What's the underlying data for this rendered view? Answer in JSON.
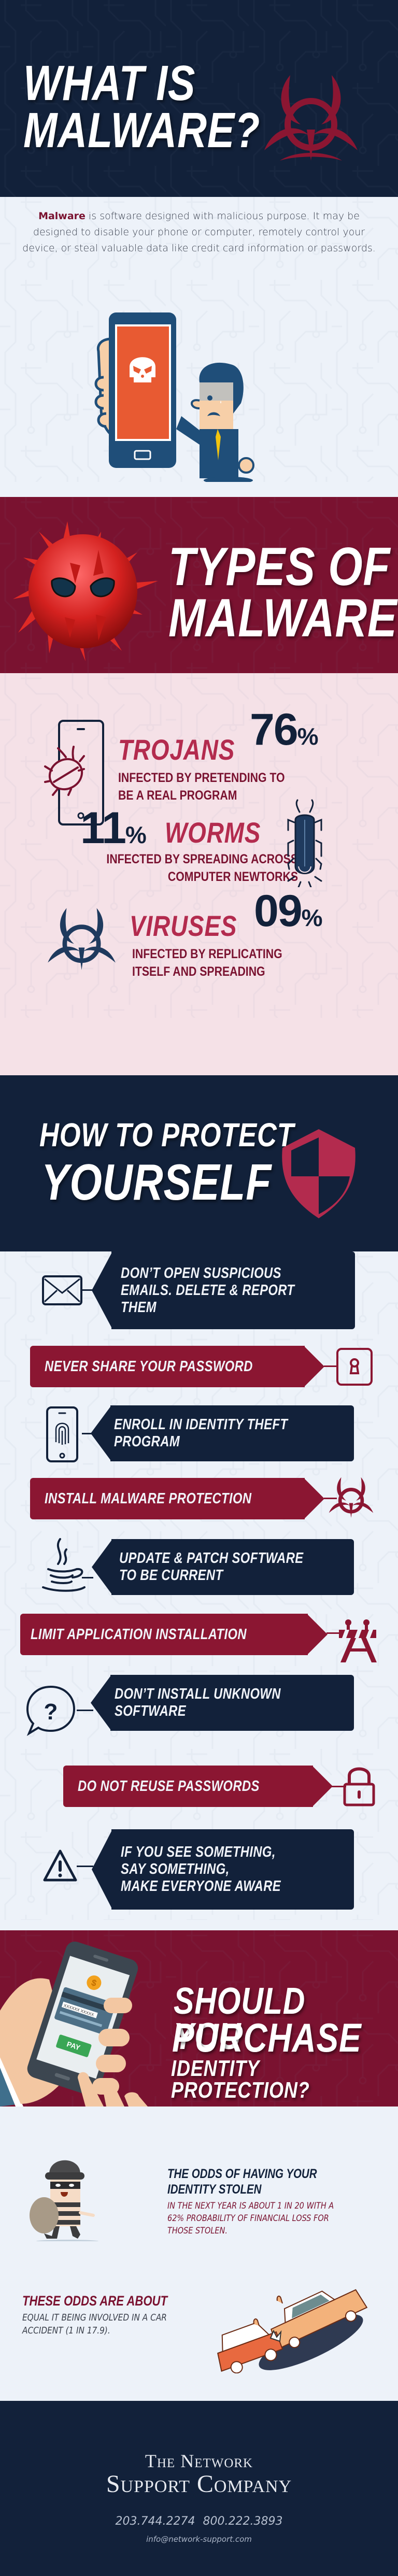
{
  "colors": {
    "navy": "#12213a",
    "maroon": "#7a1230",
    "tip_maroon": "#8b1632",
    "accent_red": "#b32b4e",
    "light_bg": "#edf2f9",
    "pink_bg": "#f5e1e7",
    "phone_screen": "#e85a32",
    "pay_green": "#3aa655"
  },
  "hero": {
    "title_line1": "WHAT IS",
    "title_line2": "MALWARE?",
    "icon": "biohazard-icon"
  },
  "intro": {
    "emphasis": "Malware",
    "text": " is software designed with malicious purpose. It may be designed to disable your phone or computer, remotely control your device, or steal valuable data like credit card information or passwords.",
    "illustration": "worried-man-holding-phone-with-skull"
  },
  "types_header": {
    "title_line1": "TYPES OF",
    "title_line2": "MALWARE",
    "icon": "spiky-virus-icon"
  },
  "types": [
    {
      "name": "TROJANS",
      "percent": "76",
      "percent_sign": "%",
      "description_line1": "INFECTED BY PRETENDING TO",
      "description_line2": "BE A REAL PROGRAM",
      "icon": "phone-bug-icon"
    },
    {
      "name": "WORMS",
      "percent": "11",
      "percent_sign": "%",
      "description_line1": "INFECTED BY SPREADING ACROSS",
      "description_line2": "COMPUTER NEWTORKS",
      "icon": "beetle-icon"
    },
    {
      "name": "VIRUSES",
      "percent": "09",
      "percent_sign": "%",
      "description_line1": "INFECTED BY REPLICATING",
      "description_line2": "ITSELF AND SPREADING",
      "icon": "biohazard-icon"
    }
  ],
  "protect_header": {
    "title_line1": "HOW TO PROTECT",
    "title_line2": "YOURSELF",
    "icon": "shield-icon"
  },
  "tips": [
    {
      "text": "DON’T OPEN SUSPICIOUS\nEMAILS. DELETE & REPORT\nTHEM",
      "icon": "envelope-icon"
    },
    {
      "text": "NEVER SHARE YOUR PASSWORD",
      "icon": "keyhole-icon"
    },
    {
      "text": "ENROLL IN IDENTITY THEFT\nPROGRAM",
      "icon": "fingerprint-phone-icon"
    },
    {
      "text": "INSTALL MALWARE PROTECTION",
      "icon": "biohazard-icon"
    },
    {
      "text": "UPDATE & PATCH SOFTWARE\nTO BE CURRENT",
      "icon": "java-cup-icon"
    },
    {
      "text": "LIMIT APPLICATION INSTALLATION",
      "icon": "barrier-icon"
    },
    {
      "text": "DON’T INSTALL UNKNOWN\nSOFTWARE",
      "icon": "question-bubble-icon"
    },
    {
      "text": "DO NOT REUSE PASSWORDS",
      "icon": "padlock-icon"
    },
    {
      "text": "IF YOU SEE SOMETHING,\nSAY SOMETHING,\n MAKE EVERYONE AWARE",
      "icon": "warning-triangle-icon"
    }
  ],
  "purchase": {
    "title_line1": "SHOULD YOU",
    "title_line2": "PURCHASE",
    "title_line3": "IDENTITY PROTECTION?",
    "phone_card_text": "XXXXXX XXXXX",
    "pay_label": "PAY",
    "coin_symbol": "$"
  },
  "odds": {
    "title_line1": "THE ODDS OF HAVING YOUR",
    "title_line2": "IDENTITY STOLEN",
    "body_line1": "IN THE NEXT YEAR IS ABOUT 1 IN 20 WITH A",
    "body_line2": "62% PROBABILITY OF FINANCIAL LOSS FOR",
    "body_line3": "THOSE STOLEN.",
    "compare_title": "THESE ODDS ARE ABOUT",
    "compare_line1": "EQUAL IT BEING INVOLVED IN A CAR",
    "compare_line2": "ACCIDENT (1 IN 17.9)."
  },
  "footer": {
    "brand_line1": "The Network",
    "brand_line2": "Support Company",
    "phone1": "203.744.2274",
    "phone2": "800.222.3893",
    "email": "info@network-support.com"
  }
}
